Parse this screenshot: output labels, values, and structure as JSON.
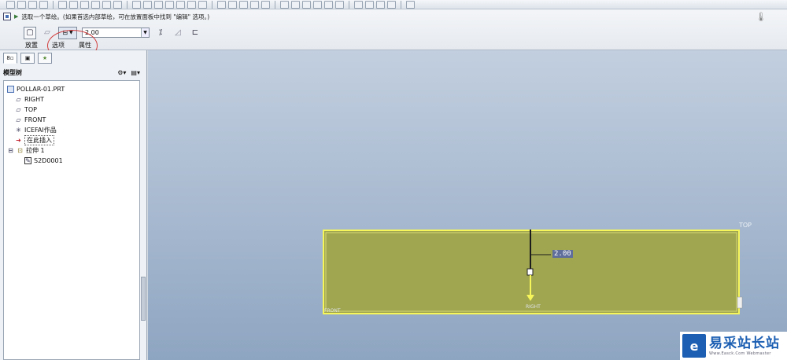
{
  "prompt": {
    "text": "选取一个草绘。(如果首选内部草绘，可在放置面板中找到 \"编辑\" 选项。)"
  },
  "dashboard": {
    "thickness_value": "2.00",
    "tabs": [
      "放置",
      "选项",
      "属性"
    ]
  },
  "model_tree": {
    "title": "模型树",
    "items": [
      {
        "label": "POLLAR-01.PRT",
        "icon": "part-icon"
      },
      {
        "label": "RIGHT",
        "icon": "datum-plane-icon"
      },
      {
        "label": "TOP",
        "icon": "datum-plane-icon"
      },
      {
        "label": "FRONT",
        "icon": "datum-plane-icon"
      },
      {
        "label": "ICEFAI作品",
        "icon": "coordinate-system-icon"
      },
      {
        "label": "在此插入",
        "icon": "insert-here-arrow-icon"
      },
      {
        "label": "拉伸 1",
        "icon": "extrude-icon"
      },
      {
        "label": "S2D0001",
        "icon": "sketch-icon"
      }
    ]
  },
  "viewport": {
    "top_label": "TOP",
    "dimension_value": "2.00",
    "right_label": "RIGHT",
    "front_label": "FRONT"
  },
  "watermark": {
    "title": "易采站长站",
    "subtitle": "Www.Easck.Com  Webmaster"
  },
  "colors": {
    "preview_fill": "#a0a650",
    "preview_edge": "#f6f55a",
    "accent": "#1c5fb3",
    "annotation_circle": "#d23b3b"
  }
}
